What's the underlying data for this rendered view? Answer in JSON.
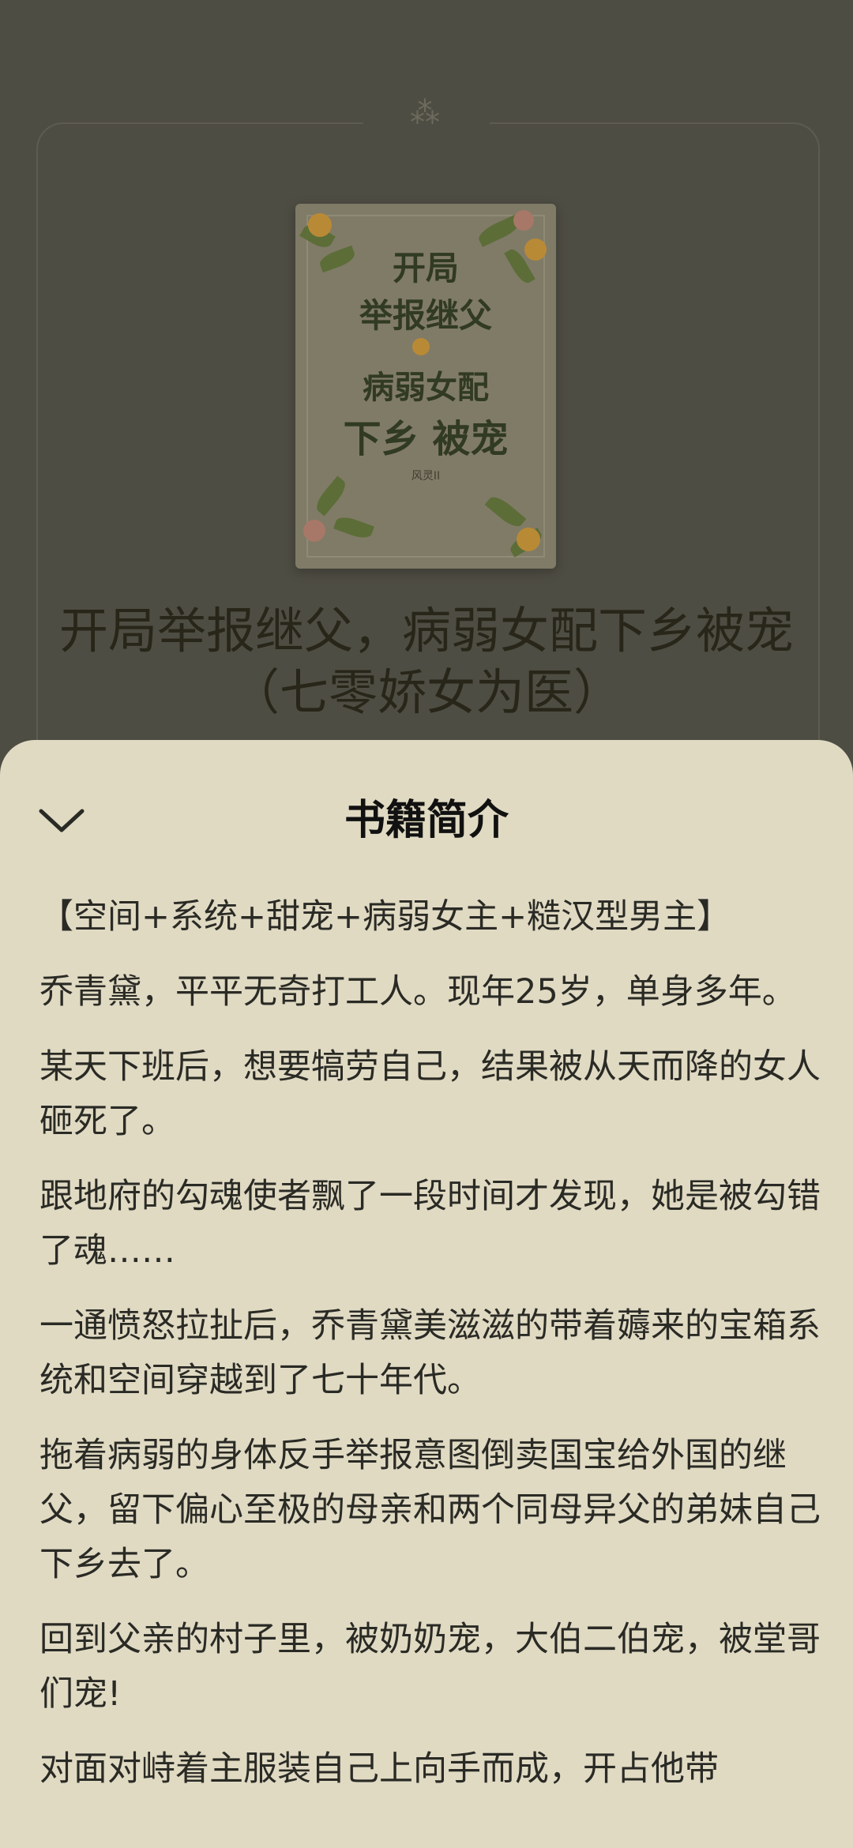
{
  "book": {
    "cover_lines": [
      "开局",
      "举报继父",
      "病弱女配",
      "下乡 被宠"
    ],
    "cover_author": "风灵II",
    "title": "开局举报继父，病弱女配下乡被宠（七零娇女为医）"
  },
  "sheet": {
    "title": "书籍简介",
    "collapse_icon": "chevron-down-icon",
    "paragraphs": [
      "【空间+系统+甜宠+病弱女主+糙汉型男主】",
      "乔青黛，平平无奇打工人。现年25岁，单身多年。",
      "某天下班后，想要犒劳自己，结果被从天而降的女人砸死了。",
      "跟地府的勾魂使者飘了一段时间才发现，她是被勾错了魂……",
      "一通愤怒拉扯后，乔青黛美滋滋的带着薅来的宝箱系统和空间穿越到了七十年代。",
      "拖着病弱的身体反手举报意图倒卖国宝给外国的继父，留下偏心至极的母亲和两个同母异父的弟妹自己下乡去了。",
      "回到父亲的村子里，被奶奶宠，大伯二伯宠，被堂哥们宠!",
      "对面对峙着主服装自己上向手而成，开占他带"
    ]
  },
  "colors": {
    "sheet_bg": "#e0dac3",
    "backdrop": "#4e4d43"
  }
}
